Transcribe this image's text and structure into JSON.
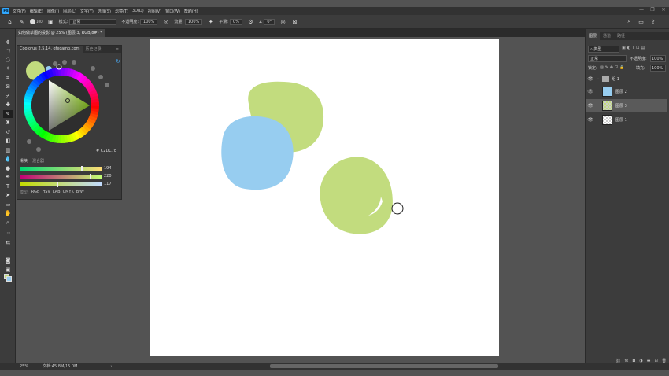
{
  "menu": {
    "app_icon": "Ps",
    "items": [
      "文件(F)",
      "编辑(E)",
      "图像(I)",
      "图层(L)",
      "文字(Y)",
      "选择(S)",
      "滤镜(T)",
      "3D(D)",
      "视图(V)",
      "窗口(W)",
      "帮助(H)"
    ],
    "window_controls": [
      "—",
      "❐",
      "✕"
    ]
  },
  "options": {
    "brush_size": "100",
    "mode_label": "模式:",
    "mode_value": "正常",
    "opacity_label": "不透明度:",
    "opacity_value": "100%",
    "flow_label": "流量:",
    "flow_value": "100%",
    "smoothing_label": "平滑:",
    "smoothing_value": "0%",
    "angle_value": "0°"
  },
  "document": {
    "tab_title": "如何做草图的投影 @ 25% (图层 3, RGB/8#) *"
  },
  "coolorus": {
    "tab_title": "Coolorus 2.5.14. gfxcamp.com",
    "tab_history": "历史记录",
    "current_color": "#c2dc7e",
    "previous_color": "#97cdf0",
    "hex_label": "# C2DC7E",
    "slider_tabs": [
      "滑块",
      "混合器"
    ],
    "sliders": [
      {
        "value": "194",
        "position": 0.76
      },
      {
        "value": "220",
        "position": 0.86
      },
      {
        "value": "117",
        "position": 0.46
      }
    ],
    "modes_label": "模型:",
    "modes": [
      "RGB",
      "HSV",
      "LAB",
      "CMYK",
      "B/W"
    ]
  },
  "layers_panel": {
    "tabs": [
      "图层",
      "通道",
      "路径"
    ],
    "filter_label": "类型",
    "blend_mode": "正常",
    "opacity_label": "不透明度:",
    "opacity_value": "100%",
    "lock_label": "锁定:",
    "fill_label": "填充:",
    "fill_value": "100%",
    "group_name": "组 1",
    "layers": [
      {
        "name": "图层 2",
        "selected": false
      },
      {
        "name": "图层 3",
        "selected": true
      },
      {
        "name": "图层 1",
        "selected": false
      }
    ],
    "bottom_icons": [
      "link-icon",
      "fx-icon",
      "mask-icon",
      "adjustment-icon",
      "group-icon",
      "new-layer-icon",
      "trash-icon"
    ]
  },
  "status": {
    "zoom": "25%",
    "doc_info": "文档:45.8M/15.0M"
  },
  "canvas": {
    "shapes": [
      {
        "name": "green-blob-top",
        "color": "#c2dc7e"
      },
      {
        "name": "blue-blob",
        "color": "#97cdf0"
      },
      {
        "name": "green-blob-right",
        "color": "#c2dc7e"
      }
    ]
  }
}
